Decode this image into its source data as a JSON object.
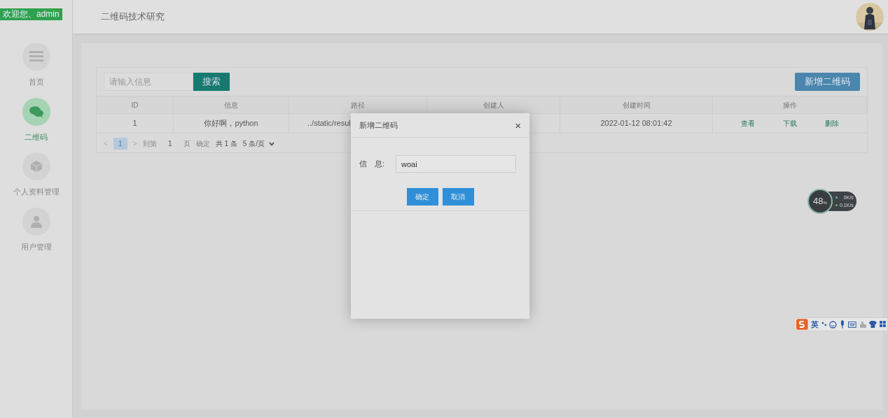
{
  "sidebar": {
    "welcome": "欢迎您、admin",
    "items": [
      {
        "label": "首页",
        "selected": false
      },
      {
        "label": "二维码",
        "selected": true
      },
      {
        "label": "个人资料管理",
        "selected": false
      },
      {
        "label": "用户管理",
        "selected": false
      }
    ]
  },
  "header": {
    "title": "二维码技术研究"
  },
  "toolbar": {
    "search": {
      "placeholder": "请输入信息"
    },
    "search_button": "搜索",
    "add_button": "新增二维码"
  },
  "table": {
    "columns": [
      "ID",
      "信息",
      "路径",
      "创建人",
      "创建时间",
      "操作"
    ],
    "rows": [
      {
        "cells": [
          "1",
          "你好啊，python",
          "../static/resul",
          "",
          "2022-01-12 08:01:42"
        ],
        "actions": [
          "查看",
          "下载",
          "删除"
        ]
      }
    ]
  },
  "pagination": {
    "prev": "<",
    "pages": [
      {
        "label": "1",
        "selected": true
      }
    ],
    "next": ">",
    "goto_label": "到第",
    "goto_value": "1",
    "page_unit": "页",
    "confirm": "确定",
    "total": "共 1 条",
    "page_size": "5 条/页"
  },
  "dialog": {
    "title": "新增二维码",
    "close": "×",
    "field_label": "信　息:",
    "field_value": "woai",
    "buttons": [
      "确定",
      "取消"
    ]
  },
  "net_widget": {
    "percent": "48",
    "percent_unit": "%",
    "up": "0K/s",
    "down": "0.1K/s"
  },
  "ime_toolbar": {
    "mode": "英"
  }
}
